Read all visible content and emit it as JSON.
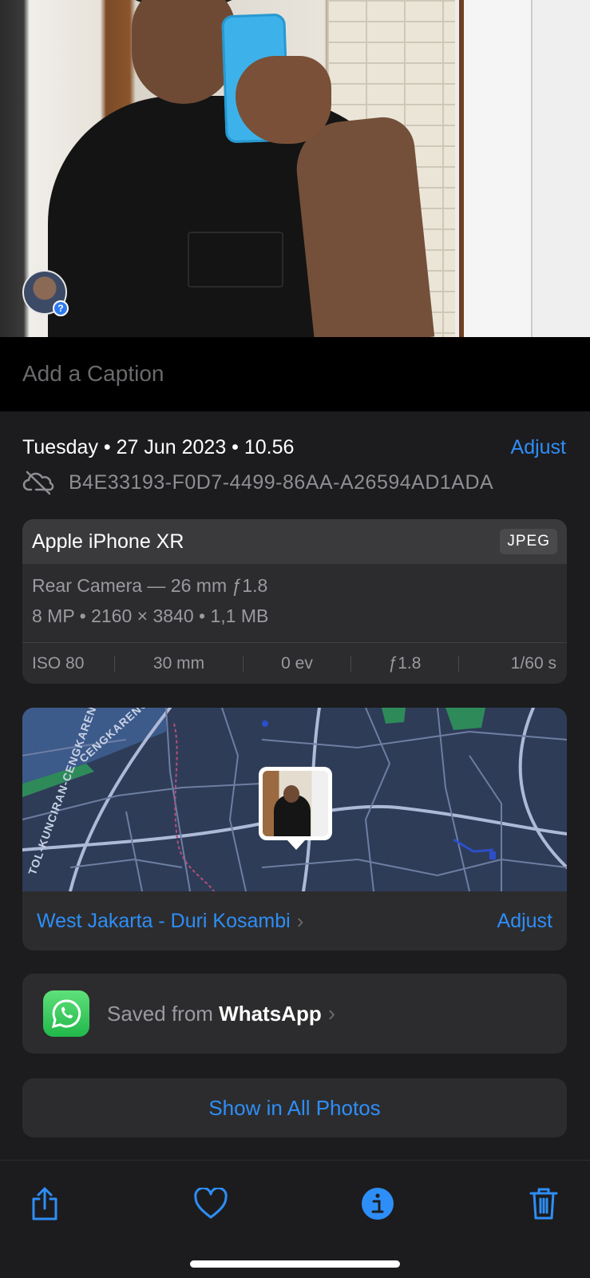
{
  "caption": {
    "placeholder": "Add a Caption"
  },
  "meta": {
    "date_line": "Tuesday • 27 Jun 2023 • 10.56",
    "adjust_label": "Adjust",
    "file_id": "B4E33193-F0D7-4499-86AA-A26594AD1ADA",
    "cloud_icon": "cloud-slash-icon"
  },
  "camera": {
    "model": "Apple iPhone XR",
    "format_badge": "JPEG",
    "lens": "Rear Camera — 26 mm ƒ1.8",
    "specs": "8 MP  •  2160 × 3840  •  1,1 MB",
    "exif": [
      "ISO 80",
      "30 mm",
      "0 ev",
      "ƒ1.8",
      "1/60 s"
    ]
  },
  "map": {
    "road_labels": [
      "CENGKARENG",
      "TOL-KUNCIRAN-CENGKARENG"
    ],
    "location": "West Jakarta - Duri Kosambi",
    "adjust_label": "Adjust"
  },
  "source": {
    "prefix": "Saved from ",
    "app": "WhatsApp"
  },
  "show_all_label": "Show in All Photos",
  "toolbar": {
    "icons": [
      "share-icon",
      "heart-icon",
      "info-icon",
      "trash-icon"
    ]
  },
  "colors": {
    "accent": "#2e8ef7",
    "background": "#1c1c1e",
    "card": "#2c2c2e",
    "secondary_text": "#8e8e93"
  }
}
